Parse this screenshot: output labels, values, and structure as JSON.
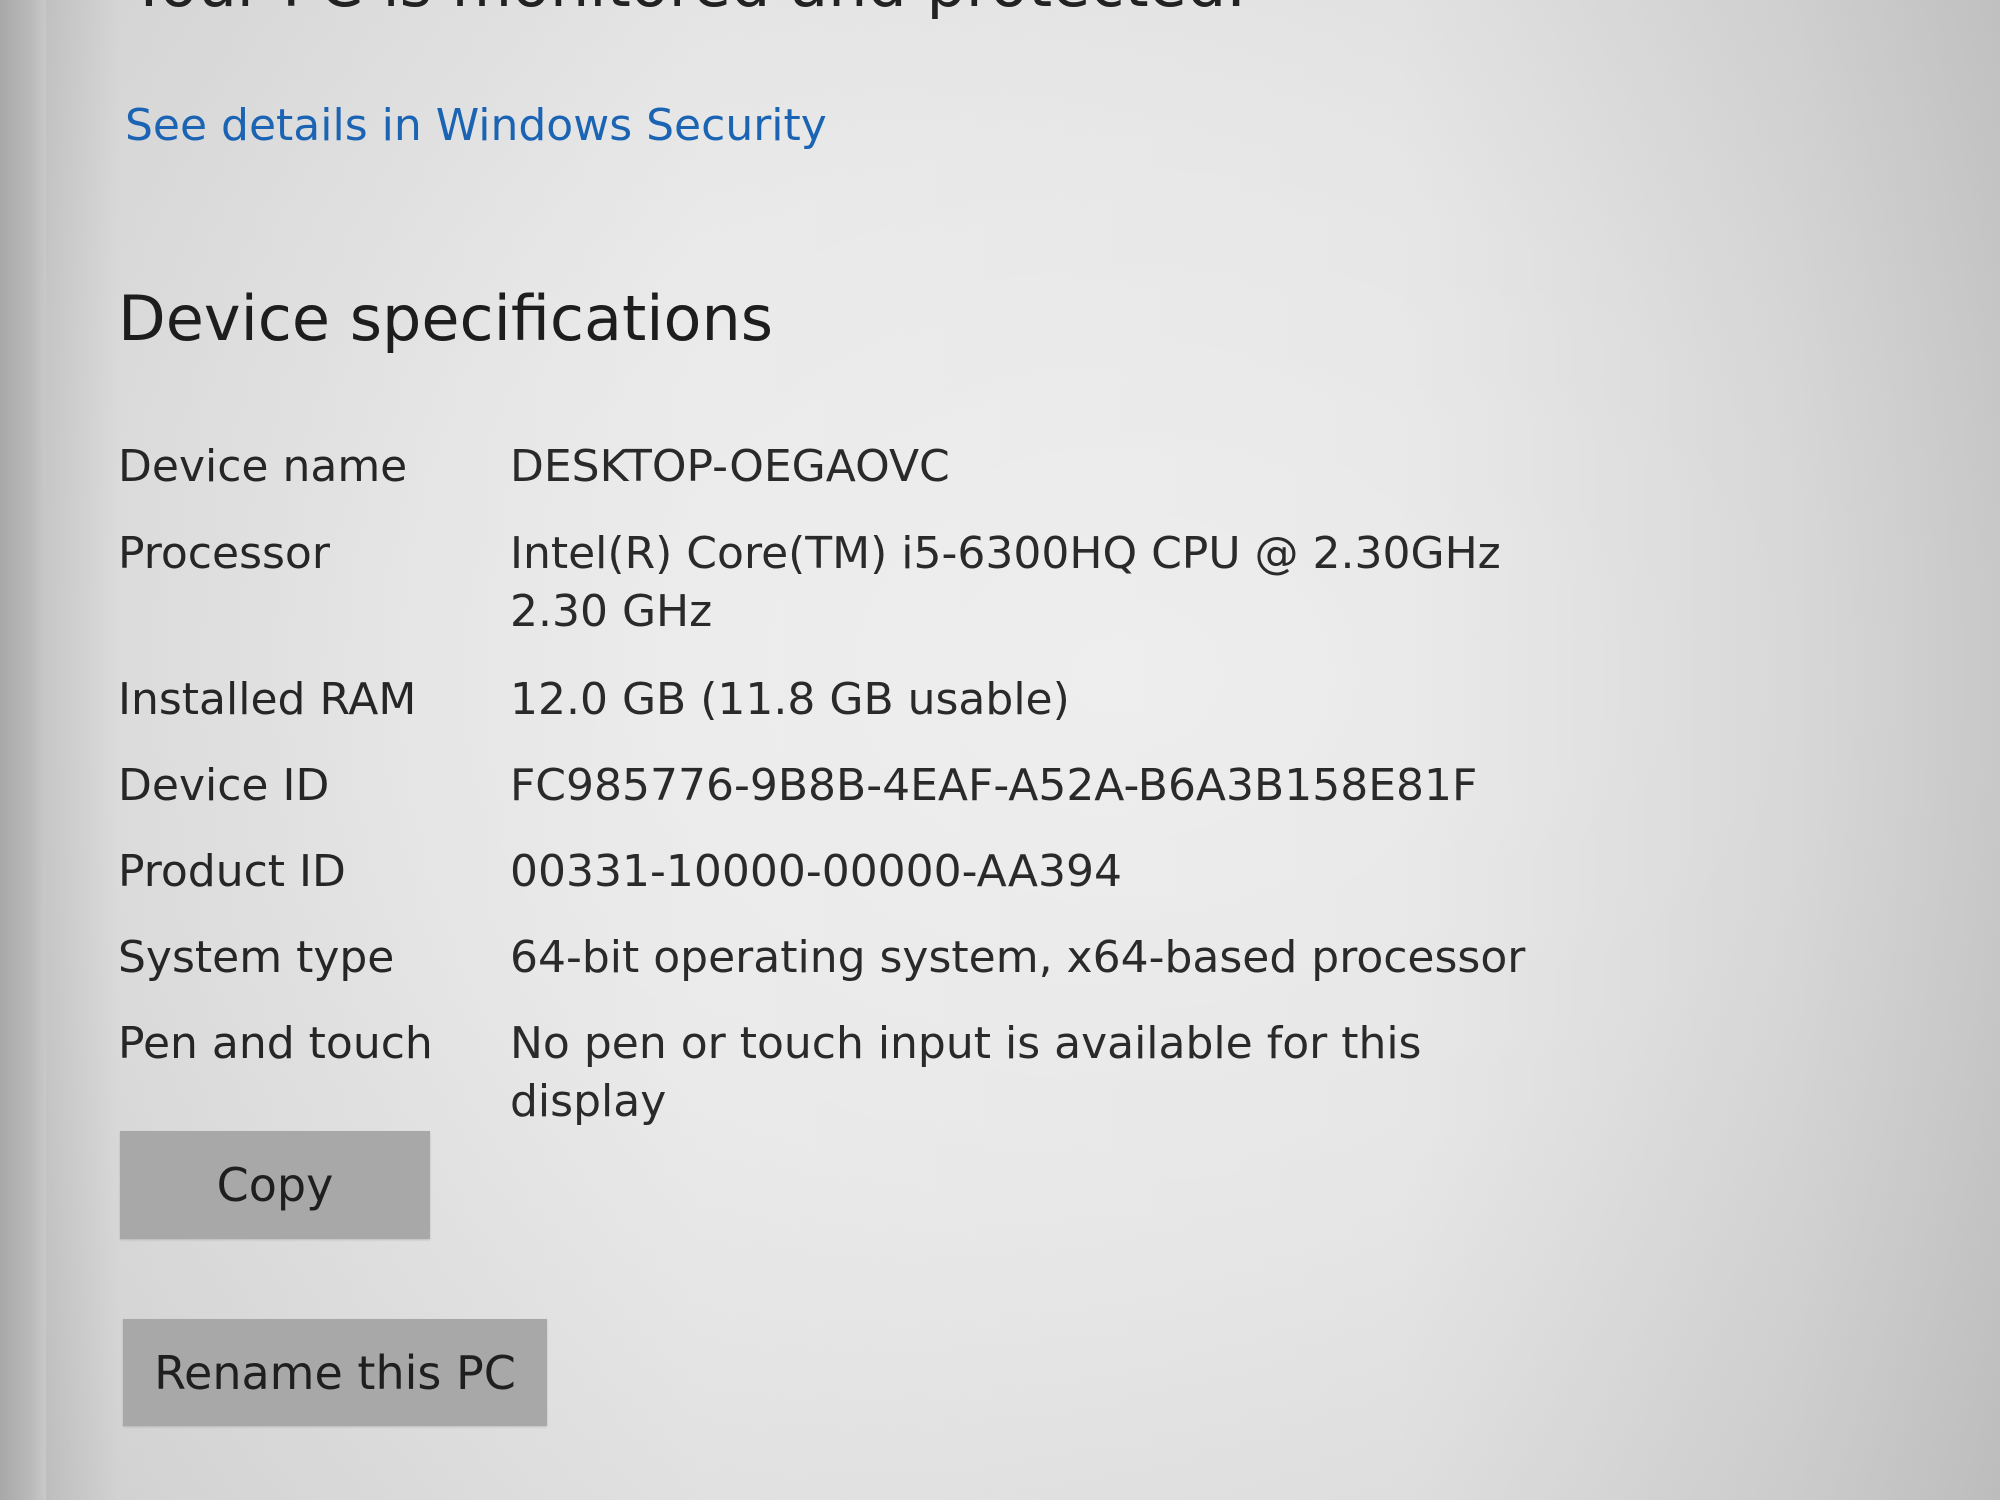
{
  "header": {
    "status_text_partial": "Your PC is monitored and protected."
  },
  "security": {
    "link_label": "See details in Windows Security"
  },
  "device_specs": {
    "title": "Device specifications",
    "rows": [
      {
        "label": "Device name",
        "value": "DESKTOP-OEGAOVC"
      },
      {
        "label": "Processor",
        "value": "Intel(R) Core(TM) i5-6300HQ CPU @ 2.30GHz   2.30 GHz"
      },
      {
        "label": "Installed RAM",
        "value": "12.0 GB (11.8 GB usable)"
      },
      {
        "label": "Device ID",
        "value": "FC985776-9B8B-4EAF-A52A-B6A3B158E81F"
      },
      {
        "label": "Product ID",
        "value": "00331-10000-00000-AA394"
      },
      {
        "label": "System type",
        "value": "64-bit operating system, x64-based processor"
      },
      {
        "label": "Pen and touch",
        "value": "No pen or touch input is available for this display"
      }
    ]
  },
  "buttons": {
    "copy_label": "Copy",
    "rename_label": "Rename this PC"
  },
  "colors": {
    "link": "#1b64b4",
    "button_bg": "#a8a8a8",
    "text": "#222222"
  }
}
